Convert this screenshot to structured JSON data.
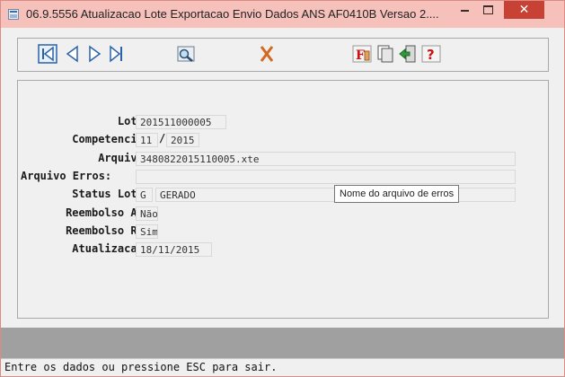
{
  "window": {
    "title": "06.9.5556 Atualizacao Lote Exportacao Envio Dados ANS AF0410B Versao 2....",
    "minimize_glyph": "−",
    "close_glyph": "✕"
  },
  "toolbar": {
    "buttons": [
      {
        "name": "first-record",
        "icon": "first-icon"
      },
      {
        "name": "previous-record",
        "icon": "previous-icon"
      },
      {
        "name": "next-record",
        "icon": "next-icon"
      },
      {
        "name": "last-record",
        "icon": "last-icon"
      },
      {
        "name": "search",
        "icon": "search-icon"
      },
      {
        "name": "cancel",
        "icon": "cancel-x-icon"
      },
      {
        "name": "function",
        "icon": "function-icon"
      },
      {
        "name": "copy",
        "icon": "copy-icon"
      },
      {
        "name": "exit",
        "icon": "exit-icon"
      },
      {
        "name": "help",
        "icon": "help-icon"
      }
    ]
  },
  "form": {
    "lote_label": "Lote:",
    "lote_value": "201511000005",
    "competencia_label": "Competencia:",
    "competencia_month": "11",
    "competencia_sep": "/",
    "competencia_year": "2015",
    "arquivo_label": "Arquivo:",
    "arquivo_value": "3480822015110005.xte",
    "arquivo_erros_label": "Arquivo Erros:",
    "arquivo_erros_value": "",
    "status_label": "Status Lote:",
    "status_code": "G",
    "status_desc": "GERADO",
    "reembolso_at_label": "Reembolso AT:",
    "reembolso_at_value": "Não",
    "reembolso_rc_label": "Reembolso RC:",
    "reembolso_rc_value": "Sim",
    "atualizacao_label": "Atualizacao:",
    "atualizacao_value": "18/11/2015"
  },
  "tooltip": "Nome do arquivo de erros",
  "status_bar": "Entre os dados ou pressione ESC para sair."
}
